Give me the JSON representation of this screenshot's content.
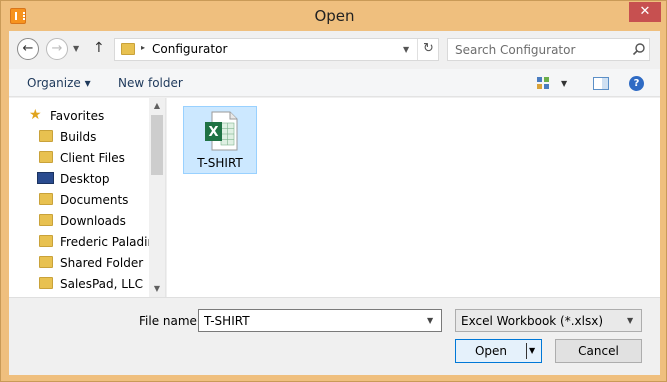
{
  "window": {
    "title": "Open",
    "close_glyph": "✕"
  },
  "address_bar": {
    "path": "Configurator",
    "separator": "▸"
  },
  "search": {
    "placeholder": "Search Configurator"
  },
  "toolbar": {
    "organize_label": "Organize ▾",
    "new_folder_label": "New folder"
  },
  "nav_pane": {
    "items": [
      {
        "label": "Favorites",
        "icon": "star-icon"
      },
      {
        "label": "Builds",
        "icon": "folder-icon"
      },
      {
        "label": "Client Files",
        "icon": "folder-icon"
      },
      {
        "label": "Desktop",
        "icon": "desktop-icon"
      },
      {
        "label": "Documents",
        "icon": "documents-icon"
      },
      {
        "label": "Downloads",
        "icon": "downloads-icon"
      },
      {
        "label": "Frederic Paladin",
        "icon": "user-folder-icon"
      },
      {
        "label": "Shared Folder",
        "icon": "folder-icon"
      },
      {
        "label": "SalesPad, LLC",
        "icon": "folder-icon"
      }
    ]
  },
  "files": [
    {
      "name": "T-SHIRT",
      "icon": "excel-file-icon",
      "selected": true
    }
  ],
  "footer": {
    "file_name_label": "File name:",
    "file_name_value": "T-SHIRT",
    "file_type_value": "Excel Workbook (*.xlsx)",
    "open_label": "Open",
    "cancel_label": "Cancel"
  },
  "colors": {
    "title_bar": "#efbf7e",
    "selection": "#cce8ff",
    "close_button": "#c75050",
    "excel_green": "#1f7244"
  }
}
